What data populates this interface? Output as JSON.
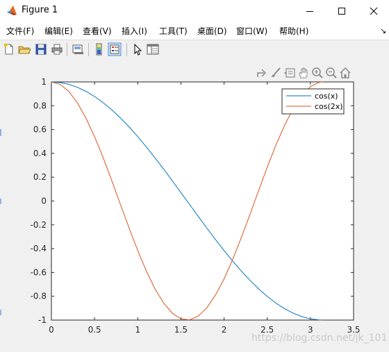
{
  "window": {
    "title": "Figure 1"
  },
  "menu": {
    "items": [
      "文件(F)",
      "编辑(E)",
      "查看(V)",
      "插入(I)",
      "工具(T)",
      "桌面(D)",
      "窗口(W)",
      "帮助(H)"
    ],
    "overflow_glyph": "↘"
  },
  "toolbar": {
    "buttons": [
      "new-figure-icon",
      "open-file-icon",
      "save-icon",
      "print-icon",
      "link-plot-icon",
      "colorbar-icon",
      "legend-icon",
      "edit-plot-cursor-icon",
      "property-inspector-icon"
    ]
  },
  "axes_toolbar": {
    "tools": [
      "export-icon",
      "brush-icon",
      "data-tips-icon",
      "pan-hand-icon",
      "zoom-in-icon",
      "zoom-out-icon",
      "home-icon"
    ]
  },
  "watermark": "https://blog.csdn.net/jk_101",
  "colors": {
    "series1": "#0072bd",
    "series2": "#d95319",
    "axes_bg": "#ffffff",
    "figure_bg": "#f0f0f0"
  },
  "chart_data": {
    "type": "line",
    "title": "",
    "xlabel": "",
    "ylabel": "",
    "xlim": [
      0,
      3.5
    ],
    "ylim": [
      -1,
      1
    ],
    "xticks": [
      0,
      0.5,
      1,
      1.5,
      2,
      2.5,
      3,
      3.5
    ],
    "xtick_labels": [
      "0",
      "0.5",
      "1",
      "1.5",
      "2",
      "2.5",
      "3",
      "3.5"
    ],
    "yticks": [
      -1,
      -0.8,
      -0.6,
      -0.4,
      -0.2,
      0,
      0.2,
      0.4,
      0.6,
      0.8,
      1
    ],
    "ytick_labels": [
      "-1",
      "-0.8",
      "-0.6",
      "-0.4",
      "-0.2",
      "0",
      "0.2",
      "0.4",
      "0.6",
      "0.8",
      "1"
    ],
    "grid": false,
    "legend_position": "top-right",
    "series": [
      {
        "name": "cos(x)",
        "color": "#0072bd",
        "x": [
          0,
          0.1,
          0.2,
          0.3,
          0.4,
          0.5,
          0.6,
          0.7,
          0.8,
          0.9,
          1.0,
          1.1,
          1.2,
          1.3,
          1.4,
          1.5,
          1.6,
          1.7,
          1.8,
          1.9,
          2.0,
          2.1,
          2.2,
          2.3,
          2.4,
          2.5,
          2.6,
          2.7,
          2.8,
          2.9,
          3.0,
          3.1,
          3.1416
        ],
        "y": [
          1.0,
          0.995,
          0.9801,
          0.9553,
          0.9211,
          0.8776,
          0.8253,
          0.7648,
          0.6967,
          0.6216,
          0.5403,
          0.4536,
          0.3624,
          0.2675,
          0.17,
          0.0707,
          -0.0292,
          -0.1288,
          -0.2272,
          -0.3233,
          -0.4161,
          -0.5048,
          -0.5885,
          -0.6663,
          -0.7374,
          -0.8011,
          -0.8569,
          -0.9041,
          -0.9422,
          -0.971,
          -0.99,
          -0.9991,
          -1.0
        ]
      },
      {
        "name": "cos(2x)",
        "color": "#d95319",
        "x": [
          0,
          0.1,
          0.2,
          0.3,
          0.4,
          0.5,
          0.6,
          0.7,
          0.8,
          0.9,
          1.0,
          1.1,
          1.2,
          1.3,
          1.4,
          1.5,
          1.6,
          1.7,
          1.8,
          1.9,
          2.0,
          2.1,
          2.2,
          2.3,
          2.4,
          2.5,
          2.6,
          2.7,
          2.8,
          2.9,
          3.0,
          3.1,
          3.1416
        ],
        "y": [
          1.0,
          0.9801,
          0.9211,
          0.8253,
          0.6967,
          0.5403,
          0.3624,
          0.17,
          -0.0292,
          -0.2272,
          -0.4161,
          -0.5885,
          -0.7374,
          -0.8569,
          -0.9422,
          -0.99,
          -0.9983,
          -0.9668,
          -0.8968,
          -0.791,
          -0.6536,
          -0.4902,
          -0.3073,
          -0.1122,
          0.0875,
          0.2837,
          0.4685,
          0.6347,
          0.7756,
          0.8855,
          0.9602,
          0.9965,
          1.0
        ]
      }
    ]
  }
}
